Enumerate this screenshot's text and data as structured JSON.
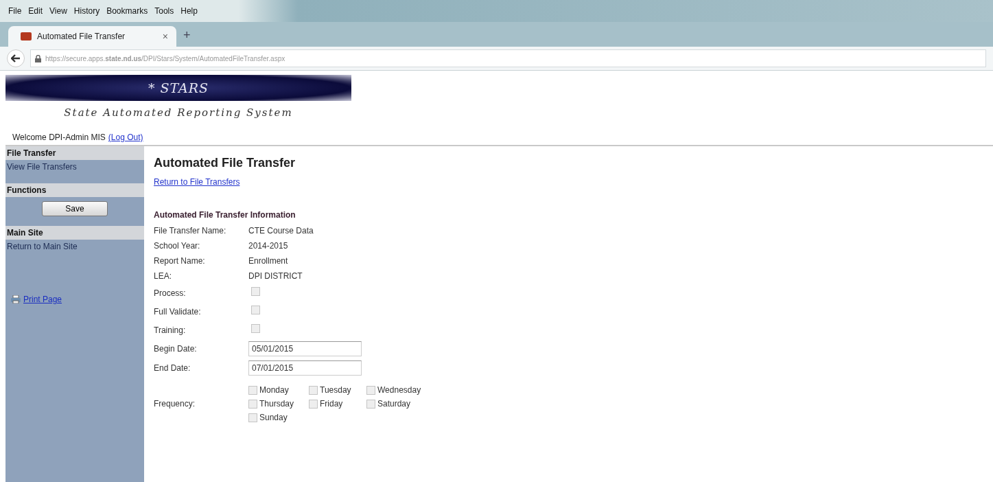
{
  "browser": {
    "menu": [
      "File",
      "Edit",
      "View",
      "History",
      "Bookmarks",
      "Tools",
      "Help"
    ],
    "tabs": [
      {
        "title": "Automated File Transfer",
        "selected": true,
        "close": "×"
      }
    ],
    "new_tab": "+",
    "url": "https://secure.apps.**state.nd.us**/DPI/Stars/System/AutomatedFileTransfer.aspx"
  },
  "banner": {
    "title": "* STARS",
    "subtitle": "State Automated Reporting System"
  },
  "welcome": {
    "text": "Welcome DPI-Admin MIS",
    "link": "(Log Out)"
  },
  "sidebar": [
    {
      "kind": "header",
      "label": "File Transfer"
    },
    {
      "kind": "link",
      "label": "View File Transfers"
    },
    {
      "kind": "header",
      "label": "Functions"
    },
    {
      "kind": "button",
      "label": "Save"
    },
    {
      "kind": "header",
      "label": "Main Site"
    },
    {
      "kind": "link",
      "label": "Return to Main Site"
    },
    {
      "kind": "print",
      "label": "Print Page"
    }
  ],
  "main": {
    "title": "Automated File Transfer",
    "back_link": "Return to File Transfers",
    "section": "Automated File Transfer Information",
    "fields": [
      {
        "kind": "text",
        "label": "File Transfer Name:",
        "value": "CTE Course Data"
      },
      {
        "kind": "text",
        "label": "School Year:",
        "value": "2014-2015"
      },
      {
        "kind": "text",
        "label": "Report Name:",
        "value": "Enrollment"
      },
      {
        "kind": "text",
        "label": "LEA:",
        "value": "DPI DISTRICT"
      },
      {
        "kind": "checkbox",
        "label": "Process:",
        "checked": false,
        "disabled": true
      },
      {
        "kind": "checkbox",
        "label": "Full Validate:",
        "checked": false,
        "disabled": true
      },
      {
        "kind": "checkbox",
        "label": "Training:",
        "checked": false,
        "disabled": true
      },
      {
        "kind": "input",
        "label": "Begin Date:",
        "value": "05/01/2015"
      },
      {
        "kind": "input",
        "label": "End Date:",
        "value": "07/01/2015"
      }
    ],
    "frequency": {
      "label": "Frequency:",
      "days": [
        {
          "label": "Monday",
          "checked": false
        },
        {
          "label": "Tuesday",
          "checked": false
        },
        {
          "label": "Wednesday",
          "checked": false
        },
        {
          "label": "Thursday",
          "checked": false
        },
        {
          "label": "Friday",
          "checked": false
        },
        {
          "label": "Saturday",
          "checked": false
        },
        {
          "label": "Sunday",
          "checked": false
        }
      ]
    }
  }
}
